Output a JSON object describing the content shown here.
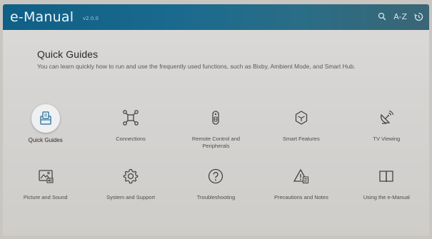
{
  "header": {
    "title": "e-Manual",
    "version": "v2.0.0",
    "icons": [
      "search-icon",
      "a-z-icon",
      "recent-icon"
    ],
    "az_label": "A-Z"
  },
  "intro": {
    "title": "Quick Guides",
    "description": "You can learn quickly how to run and use the frequently used functions, such as Bixby, Ambient Mode, and Smart Hub."
  },
  "tiles": [
    {
      "label": "Quick Guides",
      "icon": "quick-guides-icon",
      "selected": true
    },
    {
      "label": "Connections",
      "icon": "connections-icon"
    },
    {
      "label": "Remote Control and Peripherals",
      "icon": "remote-control-icon"
    },
    {
      "label": "Smart Features",
      "icon": "smart-features-icon"
    },
    {
      "label": "TV Viewing",
      "icon": "tv-viewing-icon"
    },
    {
      "label": "Picture and Sound",
      "icon": "picture-and-sound-icon"
    },
    {
      "label": "System and Support",
      "icon": "gear-icon"
    },
    {
      "label": "Troubleshooting",
      "icon": "question-icon"
    },
    {
      "label": "Precautions and Notes",
      "icon": "warning-icon"
    },
    {
      "label": "Using the e-Manual",
      "icon": "book-icon"
    }
  ],
  "colors": {
    "header_bg": "#1a6a8f",
    "icon_accent": "#3f7fa6",
    "screen_bg": "#d8d6d4"
  }
}
